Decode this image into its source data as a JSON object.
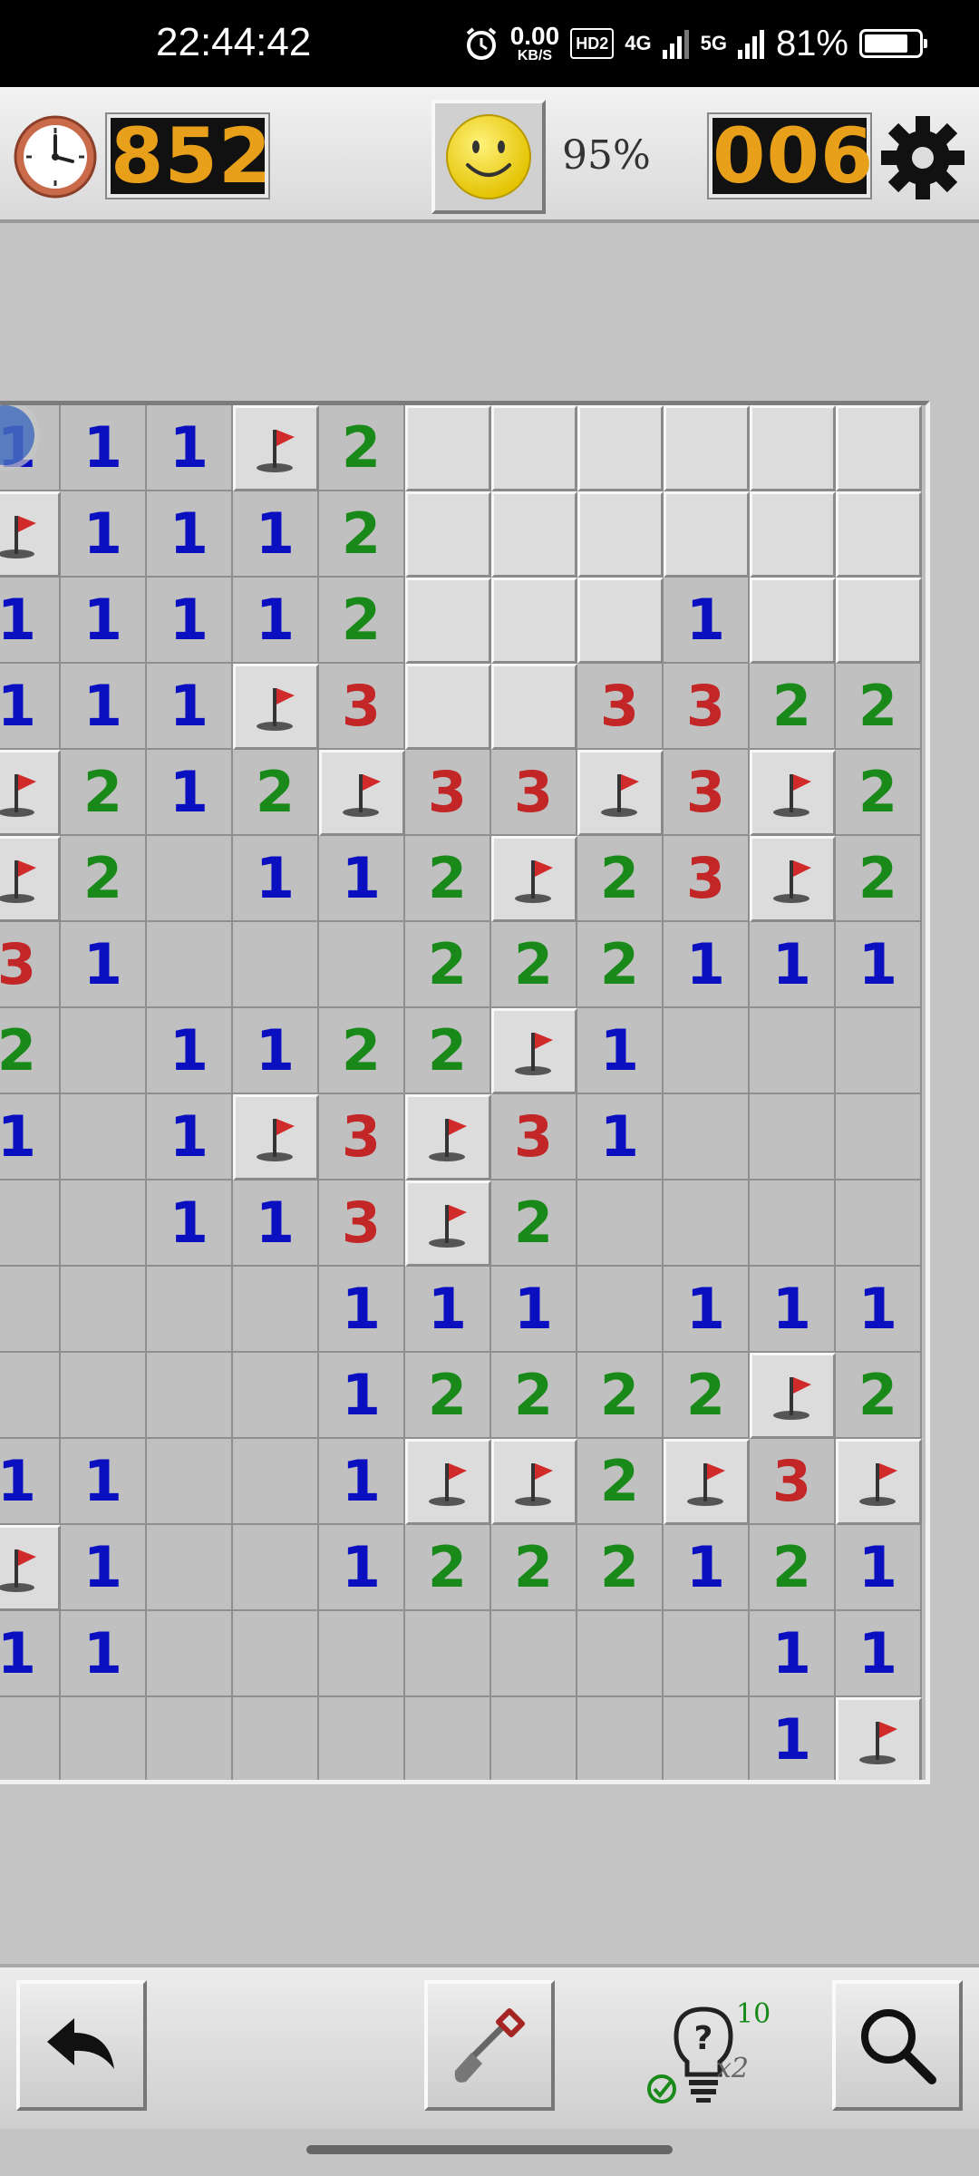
{
  "status_bar": {
    "time": "22:44:42",
    "net_speed_value": "0.00",
    "net_speed_unit": "KB/S",
    "hd_badge": "HD2",
    "net_4g": "4G",
    "net_5g": "5G",
    "battery_percent": "81%",
    "battery_level": 81,
    "icons": [
      "alarm-icon",
      "signal-icon",
      "battery-icon"
    ]
  },
  "header": {
    "timer": "852",
    "mines_left": "006",
    "progress": "95%",
    "icons": [
      "clock-icon",
      "smiley-icon",
      "gear-icon"
    ]
  },
  "board": {
    "cols": 11,
    "rows": 16,
    "legend": "H = unrevealed, F = flagged, 0 = revealed empty, 1-3 = adjacent mine count",
    "grid": [
      [
        "1",
        "1",
        "1",
        "F",
        "2",
        "H",
        "H",
        "H",
        "H",
        "H",
        "H"
      ],
      [
        "F",
        "1",
        "1",
        "1",
        "2",
        "H",
        "H",
        "H",
        "H",
        "H",
        "H"
      ],
      [
        "1",
        "1",
        "1",
        "1",
        "2",
        "H",
        "H",
        "H",
        "1",
        "H",
        "H"
      ],
      [
        "1",
        "1",
        "1",
        "F",
        "3",
        "H",
        "H",
        "3",
        "3",
        "2",
        "2"
      ],
      [
        "F",
        "2",
        "1",
        "2",
        "F",
        "3",
        "3",
        "F",
        "3",
        "F",
        "2"
      ],
      [
        "F",
        "2",
        "0",
        "1",
        "1",
        "2",
        "F",
        "2",
        "3",
        "F",
        "2"
      ],
      [
        "3",
        "1",
        "0",
        "0",
        "0",
        "2",
        "2",
        "2",
        "1",
        "1",
        "1"
      ],
      [
        "2",
        "0",
        "1",
        "1",
        "2",
        "2",
        "F",
        "1",
        "0",
        "0",
        "0"
      ],
      [
        "1",
        "0",
        "1",
        "F",
        "3",
        "F",
        "3",
        "1",
        "0",
        "0",
        "0"
      ],
      [
        "0",
        "0",
        "1",
        "1",
        "3",
        "F",
        "2",
        "0",
        "0",
        "0",
        "0"
      ],
      [
        "0",
        "0",
        "0",
        "0",
        "1",
        "1",
        "1",
        "0",
        "1",
        "1",
        "1"
      ],
      [
        "0",
        "0",
        "0",
        "0",
        "1",
        "2",
        "2",
        "2",
        "2",
        "F",
        "2"
      ],
      [
        "1",
        "1",
        "0",
        "0",
        "1",
        "F",
        "F",
        "2",
        "F",
        "3",
        "F"
      ],
      [
        "F",
        "1",
        "0",
        "0",
        "1",
        "2",
        "2",
        "2",
        "1",
        "2",
        "1"
      ],
      [
        "1",
        "1",
        "0",
        "0",
        "0",
        "0",
        "0",
        "0",
        "0",
        "1",
        "1"
      ],
      [
        "0",
        "0",
        "0",
        "0",
        "0",
        "0",
        "0",
        "0",
        "0",
        "1",
        "F"
      ]
    ]
  },
  "toolbar": {
    "hint_count": "10",
    "hint_multiplier": "x2",
    "icons": [
      "undo-icon",
      "shovel-icon",
      "hint-bulb-icon",
      "magnifier-icon"
    ]
  },
  "colors": {
    "n1": "#0a0fbf",
    "n2": "#198a19",
    "n3": "#c22626",
    "counter_digits": "#e8a01a",
    "flag": "#d12a2a"
  }
}
